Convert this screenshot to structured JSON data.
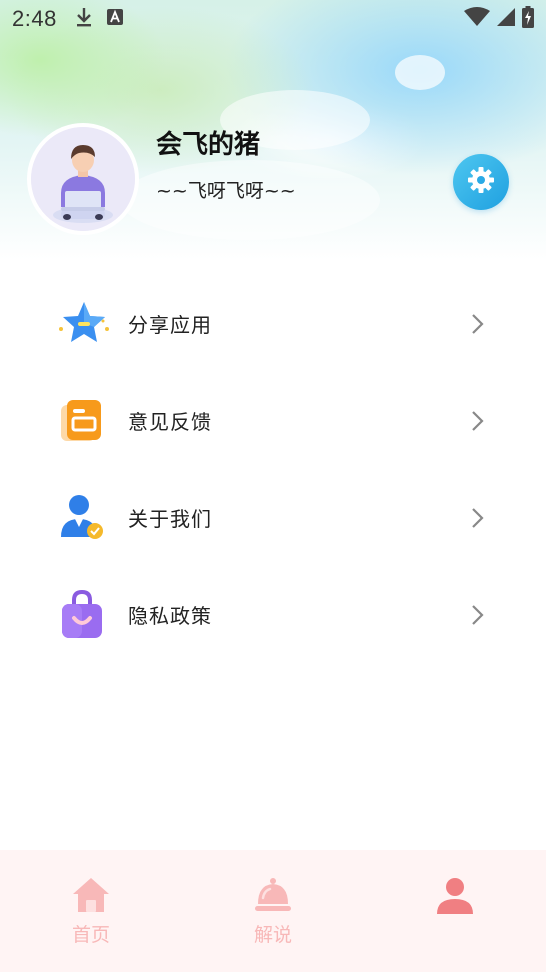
{
  "status_bar": {
    "time": "2:48",
    "left_icons": [
      "download-icon",
      "text-a-icon"
    ],
    "right_icons": [
      "wifi-icon",
      "signal-icon",
      "battery-charging-icon"
    ]
  },
  "profile": {
    "username": "会飞的猪",
    "signature": "~~飞呀飞呀~~",
    "settings_icon": "gear-icon"
  },
  "menu": {
    "items": [
      {
        "label": "分享应用",
        "icon": "star-icon"
      },
      {
        "label": "意见反馈",
        "icon": "feedback-doc-icon"
      },
      {
        "label": "关于我们",
        "icon": "user-verified-icon"
      },
      {
        "label": "隐私政策",
        "icon": "privacy-bag-icon"
      }
    ]
  },
  "tab_bar": {
    "tabs": [
      {
        "label": "首页",
        "icon": "home-icon"
      },
      {
        "label": "解说",
        "icon": "bell-icon"
      },
      {
        "label": "",
        "icon": "person-icon",
        "active": true
      }
    ]
  },
  "colors": {
    "accent_blue": "#1fa0e0",
    "tab_inactive": "#f8b8b8",
    "tab_active": "#f07f82",
    "tab_bar_bg": "#fff4f4"
  }
}
